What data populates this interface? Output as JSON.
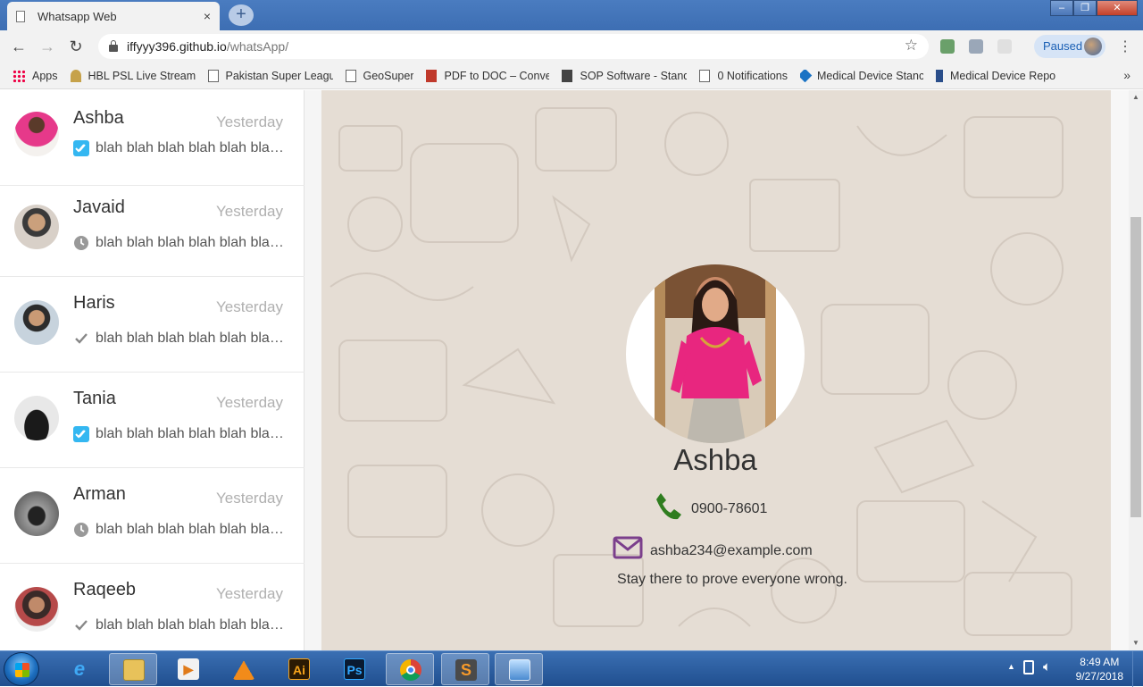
{
  "browser": {
    "tab_title": "Whatsapp Web",
    "tab_close": "×",
    "new_tab": "+",
    "url_host": "iffyyy396.github.io",
    "url_path": "/whatsApp/",
    "profile_status": "Paused",
    "bookmarks": [
      {
        "label": "Apps"
      },
      {
        "label": "HBL PSL Live Streami"
      },
      {
        "label": "Pakistan Super Leagu"
      },
      {
        "label": "GeoSuper"
      },
      {
        "label": "PDF to DOC – Conver"
      },
      {
        "label": "SOP Software - Stand"
      },
      {
        "label": "0 Notifications"
      },
      {
        "label": "Medical Device Stanc"
      },
      {
        "label": "Medical Device Repo"
      }
    ]
  },
  "chats": [
    {
      "name": "Ashba",
      "time": "Yesterday",
      "preview": "blah blah blah blah blah blah blah",
      "status": "read"
    },
    {
      "name": "Javaid",
      "time": "Yesterday",
      "preview": "blah blah blah blah blah blah blah",
      "status": "pending"
    },
    {
      "name": "Haris",
      "time": "Yesterday",
      "preview": "blah blah blah blah blah blah blah",
      "status": "sent"
    },
    {
      "name": "Tania",
      "time": "Yesterday",
      "preview": "blah blah blah blah blah blah blah",
      "status": "read"
    },
    {
      "name": "Arman",
      "time": "Yesterday",
      "preview": "blah blah blah blah blah blah blah",
      "status": "pending"
    },
    {
      "name": "Raqeeb",
      "time": "Yesterday",
      "preview": "blah blah blah blah blah blah blah",
      "status": "sent"
    }
  ],
  "profile": {
    "name": "Ashba",
    "phone": "0900-78601",
    "email": "ashba234@example.com",
    "bio": "Stay there to prove everyone wrong."
  },
  "taskbar": {
    "time": "8:49 AM",
    "date": "9/27/2018",
    "apps": [
      "internet-explorer",
      "file-explorer",
      "media-player",
      "vlc",
      "illustrator",
      "photoshop",
      "chrome",
      "sublime-text",
      "image-viewer"
    ]
  },
  "colors": {
    "read_tick": "#34b7f1",
    "phone_icon": "#2f7d1f",
    "mail_icon": "#7b3f8c",
    "wallpaper": "#e5ddd4"
  }
}
